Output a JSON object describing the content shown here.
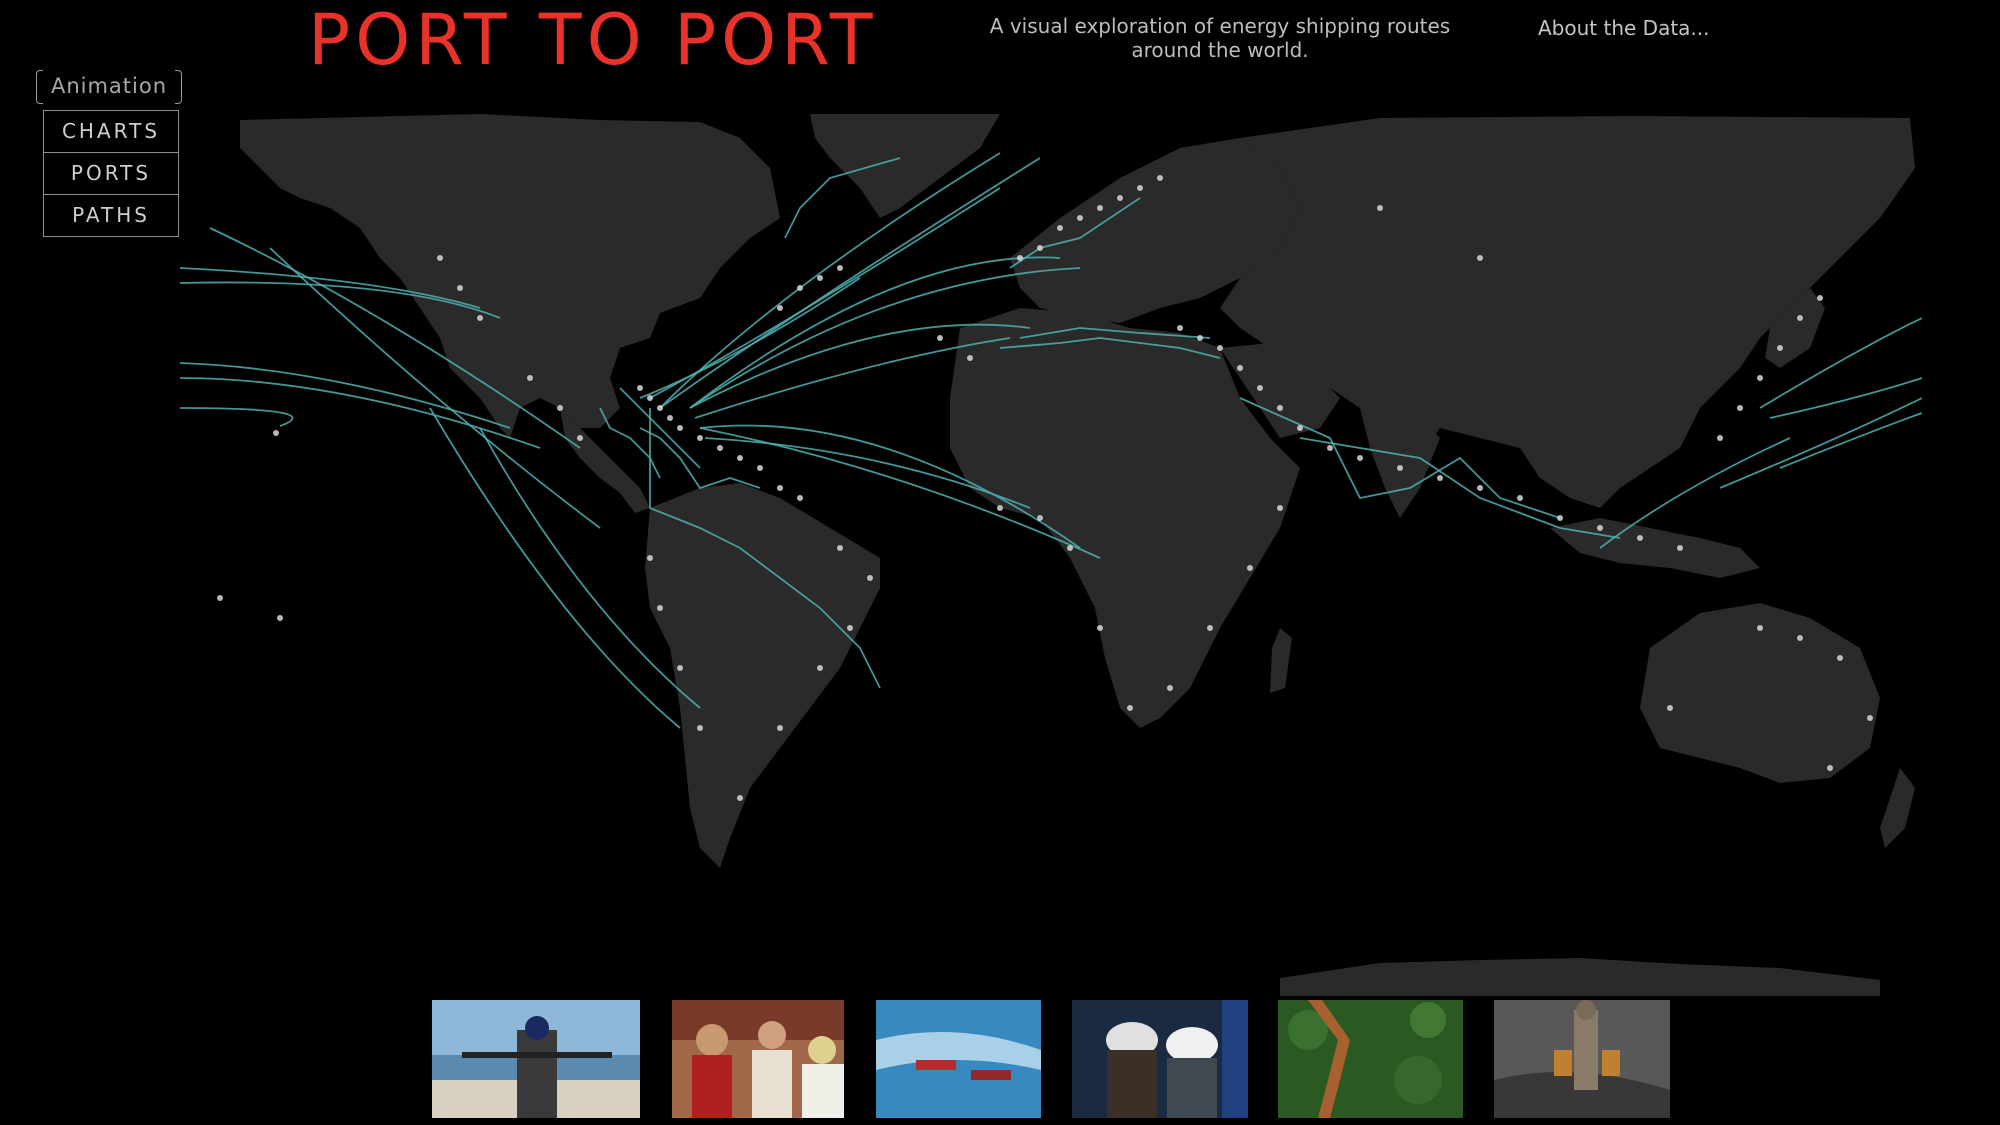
{
  "header": {
    "title": "PORT TO PORT",
    "subtitle": "A visual exploration of energy shipping routes around the world.",
    "about_link": "About the Data..."
  },
  "controls": {
    "animation_label": "Animation",
    "menu": [
      "CHARTS",
      "PORTS",
      "PATHS"
    ]
  },
  "colors": {
    "title": "#e8322a",
    "route": "#4fb0b0",
    "land": "#2b2a2a",
    "port": "#d8d8d8",
    "background": "#000000"
  },
  "thumbnails": [
    {
      "name": "photo-armed-man-beach"
    },
    {
      "name": "photo-officials-crowd"
    },
    {
      "name": "photo-tankers-sea"
    },
    {
      "name": "photo-oil-workers-helmets"
    },
    {
      "name": "photo-pipeline-forest"
    },
    {
      "name": "photo-man-carrying-cans"
    }
  ]
}
